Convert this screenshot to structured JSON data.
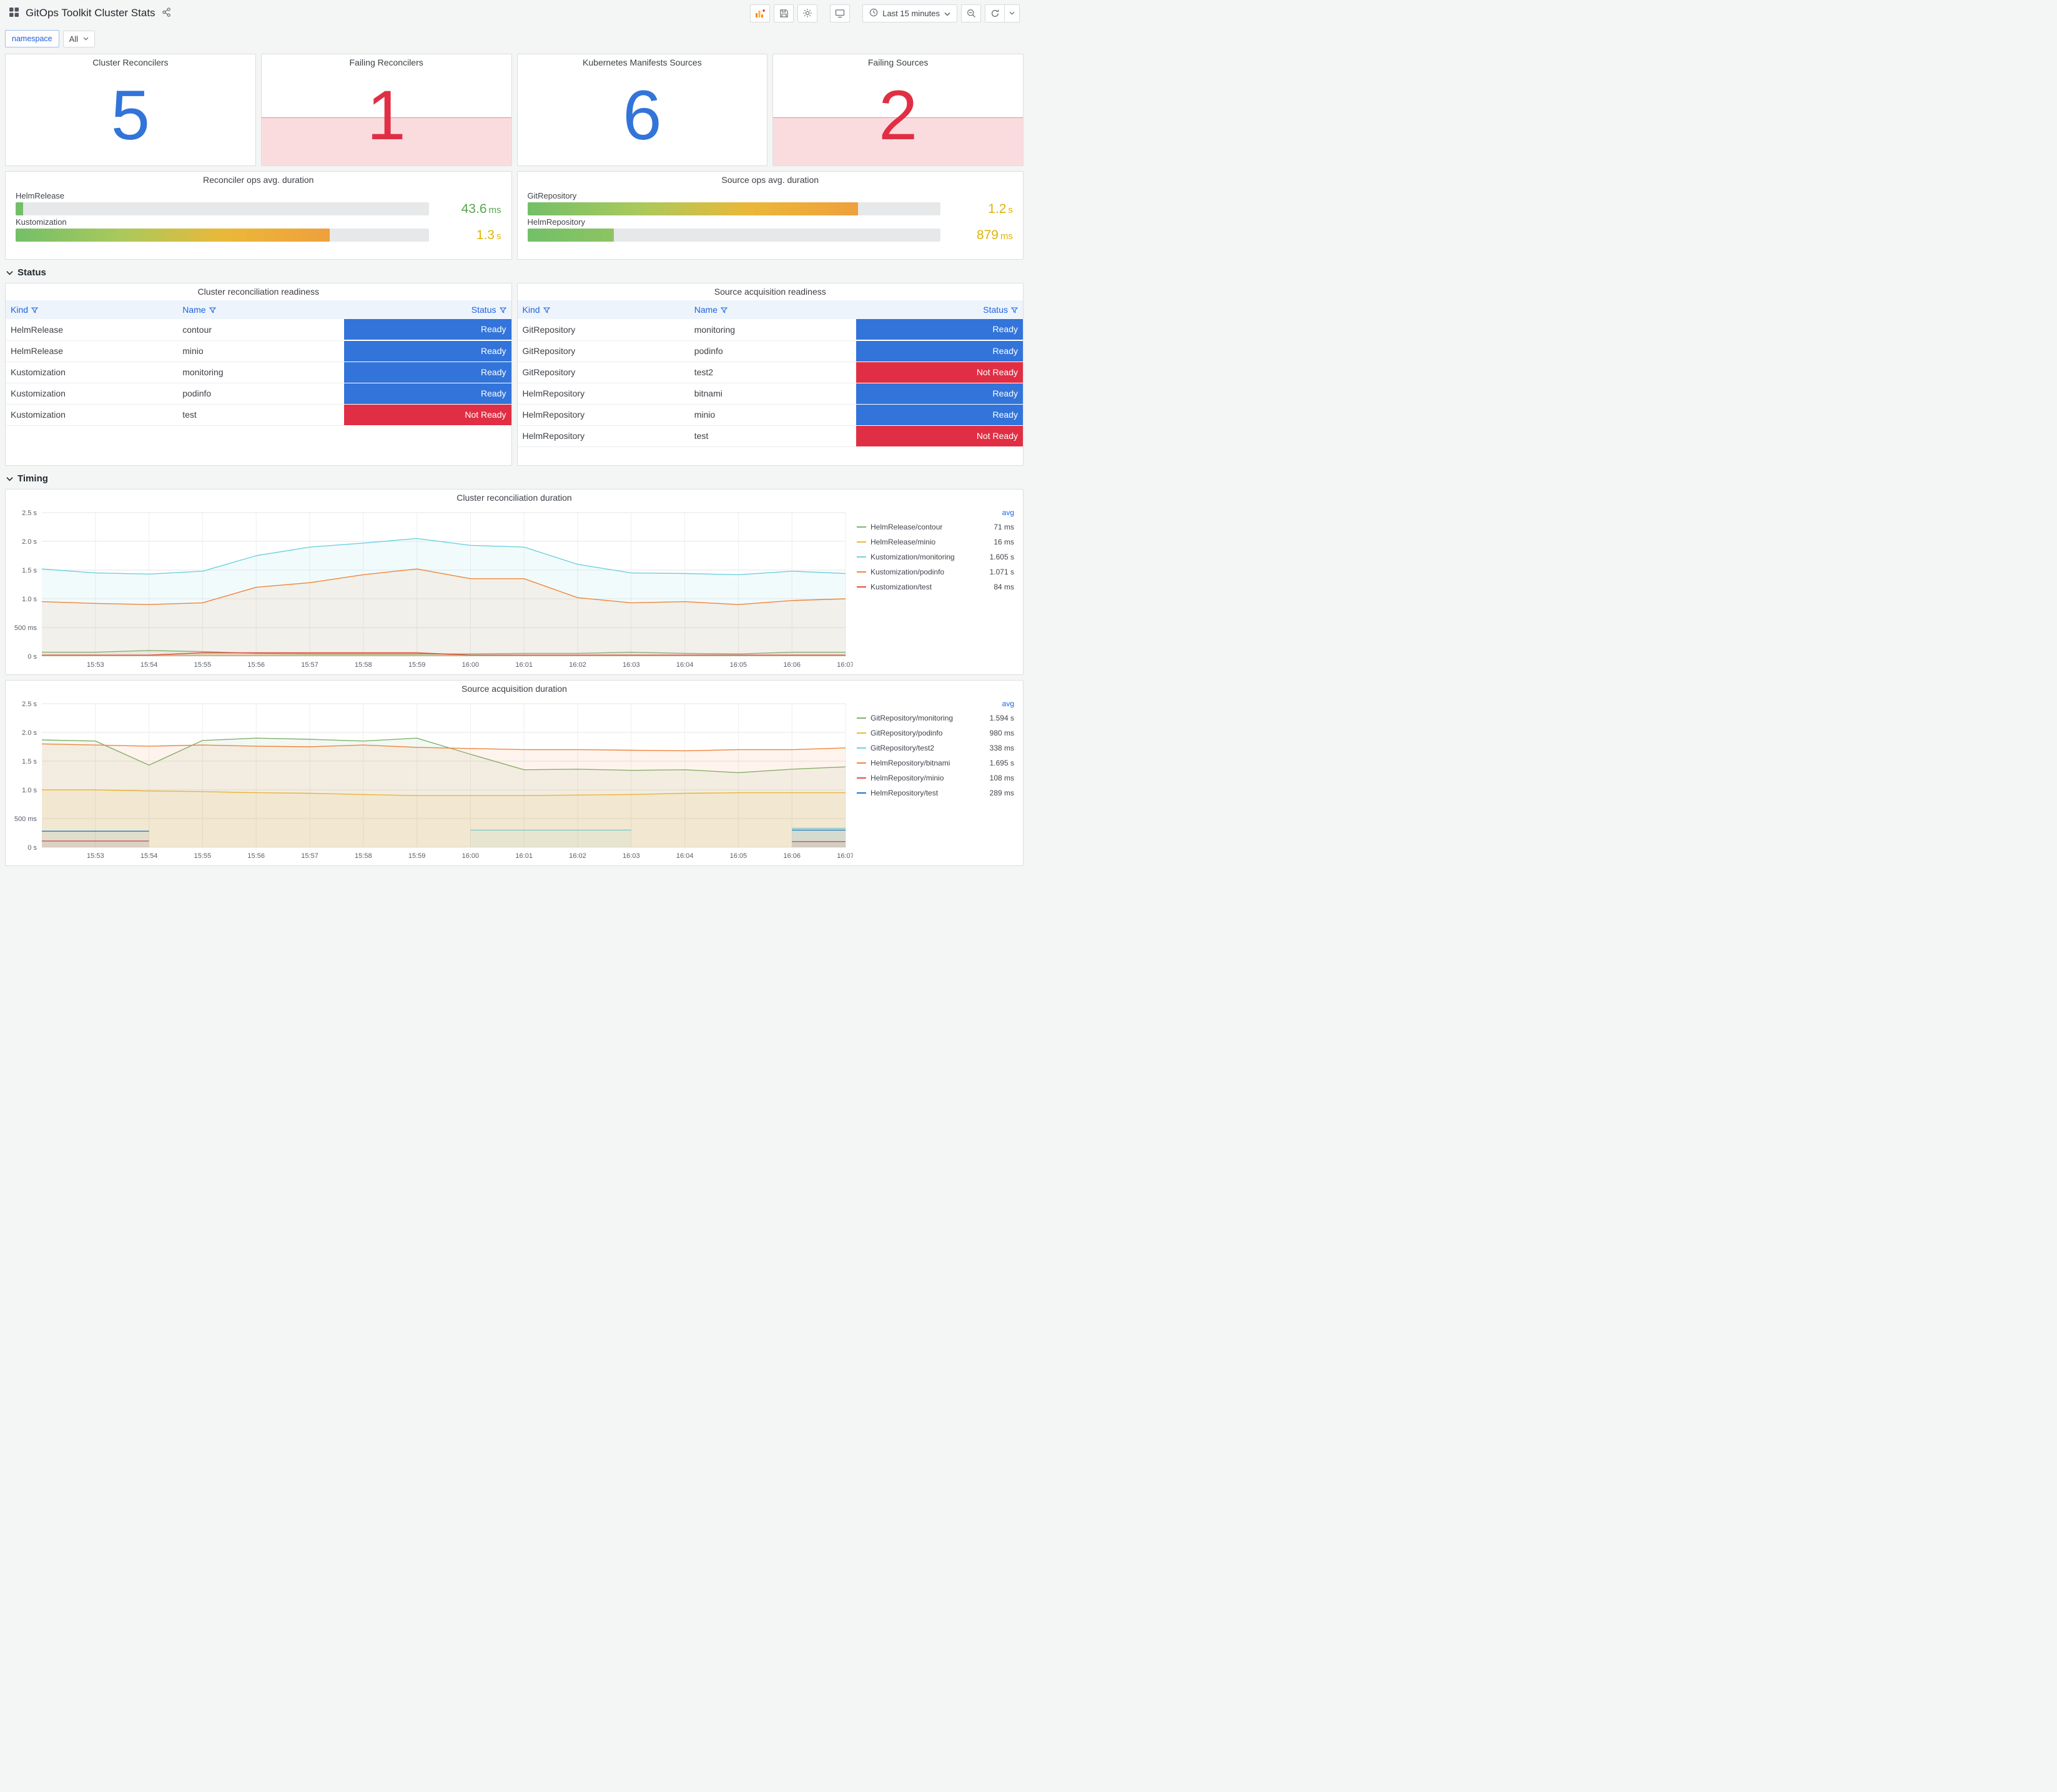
{
  "header": {
    "title": "GitOps Toolkit Cluster Stats",
    "time_range": "Last 15 minutes"
  },
  "variables": {
    "namespace_label": "namespace",
    "namespace_value": "All"
  },
  "colors": {
    "blue": "#3274d9",
    "red": "#e02f44",
    "link_blue": "#1f62e0",
    "green": "#56a64b",
    "amber": "#e0b400"
  },
  "stats": [
    {
      "title": "Cluster Reconcilers",
      "value": "5",
      "color": "#3274d9",
      "alert": false
    },
    {
      "title": "Failing Reconcilers",
      "value": "1",
      "color": "#e02f44",
      "alert": true
    },
    {
      "title": "Kubernetes Manifests Sources",
      "value": "6",
      "color": "#3274d9",
      "alert": false
    },
    {
      "title": "Failing Sources",
      "value": "2",
      "color": "#e02f44",
      "alert": true
    }
  ],
  "gauge_panels": [
    {
      "title": "Reconciler ops avg. duration",
      "rows": [
        {
          "label": "HelmRelease",
          "value": "43.6",
          "unit": "ms",
          "pct": 1.8,
          "value_color": "#56a64b",
          "bar_stops": [
            "#73bf69"
          ]
        },
        {
          "label": "Kustomization",
          "value": "1.3",
          "unit": "s",
          "pct": 76,
          "value_color": "#e0b400",
          "bar_stops": [
            "#73bf69",
            "#a9c95c",
            "#eab839",
            "#efa03c"
          ]
        }
      ]
    },
    {
      "title": "Source ops avg. duration",
      "rows": [
        {
          "label": "GitRepository",
          "value": "1.2",
          "unit": "s",
          "pct": 80,
          "value_color": "#e0b400",
          "bar_stops": [
            "#73bf69",
            "#a9c95c",
            "#eab839",
            "#efa03c"
          ]
        },
        {
          "label": "HelmRepository",
          "value": "879",
          "unit": "ms",
          "pct": 21,
          "value_color": "#e0b400",
          "bar_stops": [
            "#73bf69",
            "#8cc462"
          ]
        }
      ]
    }
  ],
  "sections": {
    "status": "Status",
    "timing": "Timing"
  },
  "status_colors": {
    "Ready": "#3274d9",
    "Not Ready": "#e02f44"
  },
  "tables": [
    {
      "title": "Cluster reconciliation readiness",
      "columns": [
        "Kind",
        "Name",
        "Status"
      ],
      "rows": [
        [
          "HelmRelease",
          "contour",
          "Ready"
        ],
        [
          "HelmRelease",
          "minio",
          "Ready"
        ],
        [
          "Kustomization",
          "monitoring",
          "Ready"
        ],
        [
          "Kustomization",
          "podinfo",
          "Ready"
        ],
        [
          "Kustomization",
          "test",
          "Not Ready"
        ]
      ]
    },
    {
      "title": "Source acquisition readiness",
      "columns": [
        "Kind",
        "Name",
        "Status"
      ],
      "rows": [
        [
          "GitRepository",
          "monitoring",
          "Ready"
        ],
        [
          "GitRepository",
          "podinfo",
          "Ready"
        ],
        [
          "GitRepository",
          "test2",
          "Not Ready"
        ],
        [
          "HelmRepository",
          "bitnami",
          "Ready"
        ],
        [
          "HelmRepository",
          "minio",
          "Ready"
        ],
        [
          "HelmRepository",
          "test",
          "Not Ready"
        ]
      ]
    }
  ],
  "chart_data": [
    {
      "type": "line",
      "title": "Cluster reconciliation duration",
      "legend_position": "right",
      "legend_value_header": "avg",
      "grid": true,
      "ylim": [
        0,
        2.5
      ],
      "y_ticks": [
        {
          "v": 0,
          "label": "0 s"
        },
        {
          "v": 0.5,
          "label": "500 ms"
        },
        {
          "v": 1,
          "label": "1.0 s"
        },
        {
          "v": 1.5,
          "label": "1.5 s"
        },
        {
          "v": 2,
          "label": "2.0 s"
        },
        {
          "v": 2.5,
          "label": "2.5 s"
        }
      ],
      "x": [
        "15:52",
        "15:53",
        "15:54",
        "15:55",
        "15:56",
        "15:57",
        "15:58",
        "15:59",
        "16:00",
        "16:01",
        "16:02",
        "16:03",
        "16:04",
        "16:05",
        "16:06",
        "16:07"
      ],
      "x_tick_labels": [
        "15:53",
        "15:54",
        "15:55",
        "15:56",
        "15:57",
        "15:58",
        "15:59",
        "16:00",
        "16:01",
        "16:02",
        "16:03",
        "16:04",
        "16:05",
        "16:06",
        "16:07"
      ],
      "series": [
        {
          "name": "HelmRelease/contour",
          "color": "#7EB26D",
          "avg": "71 ms",
          "values": [
            0.07,
            0.07,
            0.1,
            0.08,
            0.05,
            0.04,
            0.04,
            0.04,
            0.04,
            0.05,
            0.05,
            0.07,
            0.05,
            0.04,
            0.07,
            0.07
          ]
        },
        {
          "name": "HelmRelease/minio",
          "color": "#EAB839",
          "avg": "16 ms",
          "values": [
            0.016,
            0.016,
            0.016,
            0.016,
            0.016,
            0.016,
            0.016,
            0.016,
            0.016,
            0.016,
            0.016,
            0.016,
            0.016,
            0.016,
            0.016,
            0.016
          ]
        },
        {
          "name": "Kustomization/monitoring",
          "color": "#6ED0E0",
          "avg": "1.605 s",
          "values": [
            1.52,
            1.45,
            1.43,
            1.48,
            1.75,
            1.9,
            1.97,
            2.05,
            1.93,
            1.9,
            1.6,
            1.45,
            1.44,
            1.42,
            1.48,
            1.44
          ]
        },
        {
          "name": "Kustomization/podinfo",
          "color": "#EF843C",
          "avg": "1.071 s",
          "values": [
            0.95,
            0.92,
            0.9,
            0.93,
            1.2,
            1.28,
            1.42,
            1.52,
            1.35,
            1.35,
            1.02,
            0.93,
            0.95,
            0.9,
            0.97,
            1.0
          ]
        },
        {
          "name": "Kustomization/test",
          "color": "#E24D42",
          "avg": "84 ms",
          "values": [
            0.02,
            0.02,
            0.02,
            0.06,
            0.06,
            0.06,
            0.06,
            0.06,
            0.02,
            0.02,
            0.02,
            0.02,
            0.02,
            0.02,
            0.02,
            0.02
          ]
        }
      ]
    },
    {
      "type": "line",
      "title": "Source acquisition duration",
      "legend_position": "right",
      "legend_value_header": "avg",
      "grid": true,
      "ylim": [
        0,
        2.5
      ],
      "y_ticks": [
        {
          "v": 0,
          "label": "0 s"
        },
        {
          "v": 0.5,
          "label": "500 ms"
        },
        {
          "v": 1,
          "label": "1.0 s"
        },
        {
          "v": 1.5,
          "label": "1.5 s"
        },
        {
          "v": 2,
          "label": "2.0 s"
        },
        {
          "v": 2.5,
          "label": "2.5 s"
        }
      ],
      "x": [
        "15:52",
        "15:53",
        "15:54",
        "15:55",
        "15:56",
        "15:57",
        "15:58",
        "15:59",
        "16:00",
        "16:01",
        "16:02",
        "16:03",
        "16:04",
        "16:05",
        "16:06",
        "16:07"
      ],
      "x_tick_labels": [
        "15:53",
        "15:54",
        "15:55",
        "15:56",
        "15:57",
        "15:58",
        "15:59",
        "16:00",
        "16:01",
        "16:02",
        "16:03",
        "16:04",
        "16:05",
        "16:06",
        "16:07"
      ],
      "series": [
        {
          "name": "GitRepository/monitoring",
          "color": "#7EB26D",
          "avg": "1.594 s",
          "values": [
            1.87,
            1.85,
            1.43,
            1.86,
            1.9,
            1.88,
            1.85,
            1.9,
            1.62,
            1.35,
            1.36,
            1.34,
            1.35,
            1.3,
            1.36,
            1.4
          ]
        },
        {
          "name": "GitRepository/podinfo",
          "color": "#EAB839",
          "avg": "980 ms",
          "values": [
            1.0,
            1.0,
            0.98,
            0.97,
            0.95,
            0.94,
            0.92,
            0.9,
            0.9,
            0.9,
            0.91,
            0.92,
            0.94,
            0.95,
            0.95,
            0.95
          ]
        },
        {
          "name": "GitRepository/test2",
          "color": "#6ED0E0",
          "avg": "338 ms",
          "values": [
            null,
            null,
            null,
            null,
            null,
            null,
            null,
            null,
            0.3,
            0.3,
            0.3,
            0.3,
            null,
            null,
            0.33,
            0.33
          ]
        },
        {
          "name": "HelmRepository/bitnami",
          "color": "#EF843C",
          "avg": "1.695 s",
          "values": [
            1.8,
            1.78,
            1.76,
            1.78,
            1.76,
            1.75,
            1.78,
            1.74,
            1.72,
            1.7,
            1.7,
            1.69,
            1.68,
            1.7,
            1.7,
            1.73
          ]
        },
        {
          "name": "HelmRepository/minio",
          "color": "#E24D42",
          "avg": "108 ms",
          "values": [
            0.11,
            0.11,
            0.11,
            null,
            null,
            null,
            null,
            null,
            null,
            null,
            null,
            null,
            null,
            null,
            0.1,
            0.1
          ]
        },
        {
          "name": "HelmRepository/test",
          "color": "#1F78C1",
          "avg": "289 ms",
          "values": [
            0.28,
            0.28,
            0.28,
            null,
            null,
            null,
            null,
            null,
            null,
            null,
            null,
            null,
            null,
            null,
            0.3,
            0.3
          ]
        }
      ]
    }
  ]
}
